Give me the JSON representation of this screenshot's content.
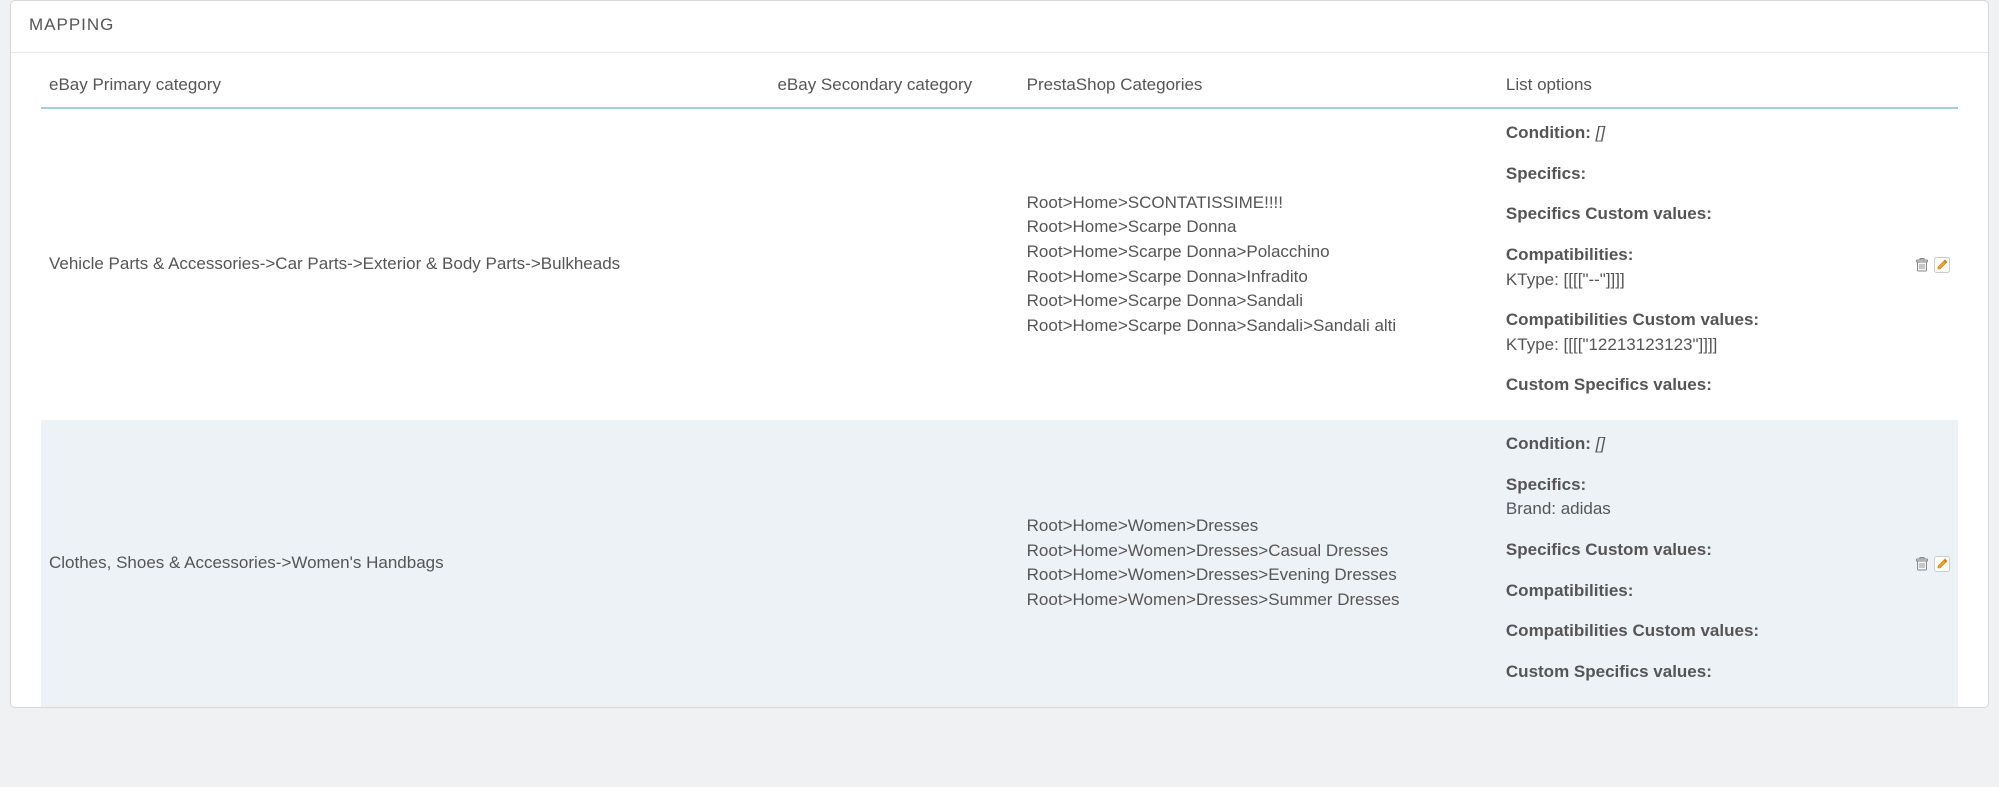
{
  "panel": {
    "title": "MAPPING"
  },
  "columns": {
    "c1": "eBay Primary category",
    "c2": "eBay Secondary category",
    "c3": "PrestaShop Categories",
    "c4": "List options"
  },
  "labels": {
    "condition": "Condition:",
    "specifics": "Specifics:",
    "specifics_custom": "Specifics Custom values:",
    "compat": "Compatibilities:",
    "compat_custom": "Compatibilities Custom values:",
    "custom_specifics": "Custom Specifics values:"
  },
  "rows": [
    {
      "primary": "Vehicle Parts & Accessories->Car Parts->Exterior & Body Parts->Bulkheads",
      "secondary": "",
      "ps": [
        "Root>Home>SCONTATISSIME!!!!",
        "Root>Home>Scarpe Donna",
        "Root>Home>Scarpe Donna>Polacchino",
        "Root>Home>Scarpe Donna>Infradito",
        "Root>Home>Scarpe Donna>Sandali",
        "Root>Home>Scarpe Donna>Sandali>Sandali alti"
      ],
      "condition_val": "[]",
      "specifics_lines": [],
      "compat_lines": [
        "KType: [[[[\"--\"]]]]"
      ],
      "compat_custom_lines": [
        "KType: [[[[\"12213123123\"]]]]"
      ]
    },
    {
      "primary": "Clothes, Shoes & Accessories->Women's Handbags",
      "secondary": "",
      "ps": [
        "Root>Home>Women>Dresses",
        "Root>Home>Women>Dresses>Casual Dresses",
        "Root>Home>Women>Dresses>Evening Dresses",
        "Root>Home>Women>Dresses>Summer Dresses"
      ],
      "condition_val": "[]",
      "specifics_lines": [
        "Brand: adidas"
      ],
      "compat_lines": [],
      "compat_custom_lines": []
    }
  ]
}
